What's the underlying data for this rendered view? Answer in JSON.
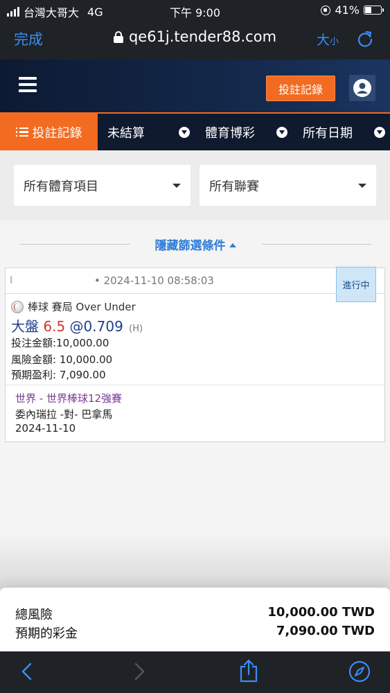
{
  "status_bar": {
    "carrier": "台灣大哥大",
    "network": "4G",
    "time": "下午 9:00",
    "battery": "41%",
    "battery_level": 0.41
  },
  "browser": {
    "done_label": "完成",
    "url": "qe61j.tender88.com",
    "text_size_big": "大",
    "text_size_small": "小",
    "icons": [
      "padlock-icon",
      "reload-icon"
    ]
  },
  "header": {
    "record_button": "投註記錄",
    "icons": [
      "hamburger-icon",
      "user-icon"
    ]
  },
  "tabs": {
    "active": "投註記錄",
    "items": [
      "未結算",
      "體育博彩",
      "所有日期"
    ]
  },
  "filters": {
    "sport": "所有體育項目",
    "league": "所有聯賽"
  },
  "toggle_filters": "隱藏篩選條件",
  "bet": {
    "id_prefix": "I",
    "timestamp": "• 2024-11-10 08:58:03",
    "status": "進行中",
    "sport": "棒球 賽局 Over Under",
    "selection": "大盤",
    "handicap": "6.5",
    "odds": "@0.709",
    "side": "(H)",
    "stake": "投注金額:10,000.00",
    "risk": "風險金額: 10,000.00",
    "expected_win": "預期盈利: 7,090.00",
    "league": "世界 - 世界棒球12強賽",
    "match": "委內瑞拉 -對- 巴拿馬",
    "match_date": "2024-11-10"
  },
  "summary": {
    "total_risk_label": "總風險",
    "total_risk_value": "10,000.00 TWD",
    "expected_payout_label": "預期的彩金",
    "expected_payout_value": "7,090.00 TWD"
  },
  "colors": {
    "accent": "#f26b21",
    "link_blue": "#2f7dd6",
    "dark_bar": "#1f2226",
    "header_navy": "#0d1a33"
  }
}
